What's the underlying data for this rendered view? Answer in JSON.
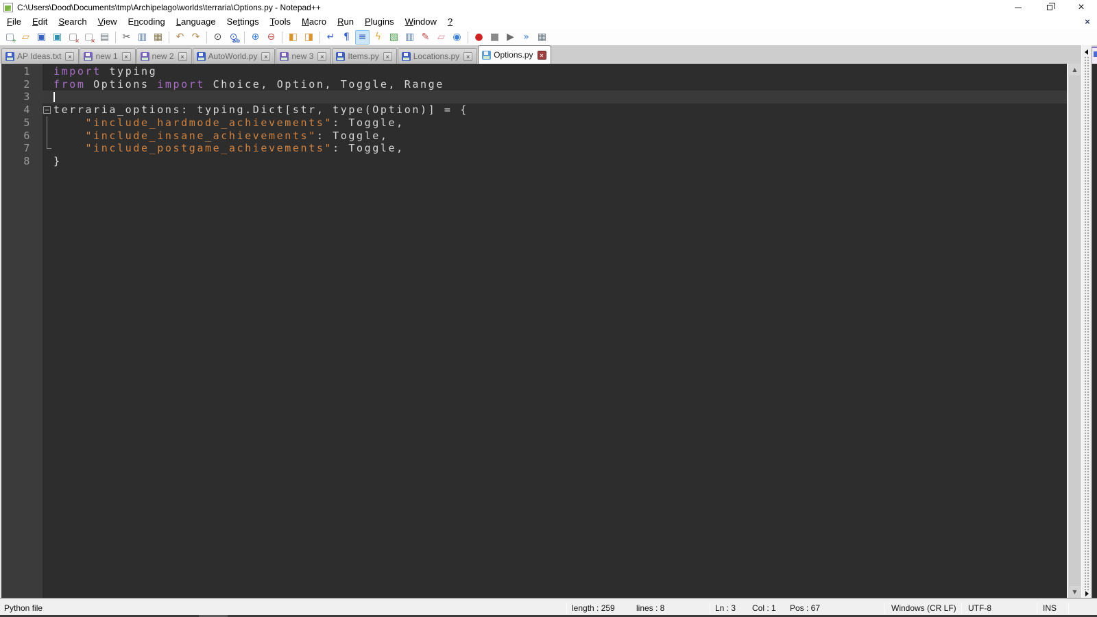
{
  "window": {
    "title": "C:\\Users\\Dood\\Documents\\tmp\\Archipelago\\worlds\\terraria\\Options.py - Notepad++"
  },
  "menu": {
    "items": [
      {
        "label": "File",
        "mnemonic": 0
      },
      {
        "label": "Edit",
        "mnemonic": 0
      },
      {
        "label": "Search",
        "mnemonic": 0
      },
      {
        "label": "View",
        "mnemonic": 0
      },
      {
        "label": "Encoding",
        "mnemonic": 1
      },
      {
        "label": "Language",
        "mnemonic": 0
      },
      {
        "label": "Settings",
        "mnemonic": 2
      },
      {
        "label": "Tools",
        "mnemonic": 0
      },
      {
        "label": "Macro",
        "mnemonic": 0
      },
      {
        "label": "Run",
        "mnemonic": 0
      },
      {
        "label": "Plugins",
        "mnemonic": 0
      },
      {
        "label": "Window",
        "mnemonic": 0
      },
      {
        "label": "?",
        "mnemonic": 0
      }
    ],
    "close_button_glyph": "×"
  },
  "toolbar": {
    "items": [
      {
        "name": "new-file",
        "glyph": "▢",
        "color": "#7d8aa0",
        "badge": "+",
        "badge_color": "#3a9e3a"
      },
      {
        "name": "open-file",
        "glyph": "▱",
        "color": "#d9952f"
      },
      {
        "name": "save",
        "glyph": "▣",
        "color": "#3a62c4"
      },
      {
        "name": "save-all",
        "glyph": "▣",
        "color": "#2f8fae"
      },
      {
        "name": "close",
        "glyph": "▢",
        "color": "#8a8a8a",
        "badge": "×",
        "badge_color": "#c0504d"
      },
      {
        "name": "close-all",
        "glyph": "▢",
        "color": "#9a9a9a",
        "badge": "×",
        "badge_color": "#c0504d"
      },
      {
        "name": "print",
        "glyph": "▤",
        "color": "#6c7a89"
      },
      {
        "sep": true
      },
      {
        "name": "cut",
        "glyph": "✂",
        "color": "#5a5a5a"
      },
      {
        "name": "copy",
        "glyph": "▥",
        "color": "#5b7fb5"
      },
      {
        "name": "paste",
        "glyph": "▦",
        "color": "#8a7a52"
      },
      {
        "sep": true
      },
      {
        "name": "undo",
        "glyph": "↶",
        "color": "#b08a4f"
      },
      {
        "name": "redo",
        "glyph": "↷",
        "color": "#b08a4f"
      },
      {
        "sep": true
      },
      {
        "name": "find",
        "glyph": "⊙",
        "color": "#444444"
      },
      {
        "name": "replace",
        "glyph": "⊙",
        "color": "#3a62c4",
        "badge": "ab",
        "badge_color": "#3a62c4"
      },
      {
        "sep": true
      },
      {
        "name": "zoom-in",
        "glyph": "⊕",
        "color": "#3a7fd5"
      },
      {
        "name": "zoom-out",
        "glyph": "⊖",
        "color": "#c0504d"
      },
      {
        "sep": true
      },
      {
        "name": "sync-vertical",
        "glyph": "◧",
        "color": "#d9952f"
      },
      {
        "name": "sync-horizontal",
        "glyph": "◨",
        "color": "#d9952f"
      },
      {
        "sep": true
      },
      {
        "name": "word-wrap",
        "glyph": "↵",
        "color": "#3a62c4"
      },
      {
        "name": "show-all-characters",
        "glyph": "¶",
        "color": "#3a62c4"
      },
      {
        "name": "indent-guide",
        "glyph": "≡",
        "color": "#3a62c4",
        "pressed": true
      },
      {
        "name": "function-list",
        "glyph": "ϟ",
        "color": "#e0a526"
      },
      {
        "name": "document-map",
        "glyph": "▧",
        "color": "#4a9e4a"
      },
      {
        "name": "document-list",
        "glyph": "▥",
        "color": "#5b7fb5"
      },
      {
        "name": "document-switcher",
        "glyph": "✎",
        "color": "#c0504d"
      },
      {
        "name": "folder-as-workspace",
        "glyph": "▱",
        "color": "#d98a9a"
      },
      {
        "name": "file-monitoring",
        "glyph": "◉",
        "color": "#3a7fd5"
      },
      {
        "sep": true
      },
      {
        "name": "macro-record",
        "glyph": "●",
        "color": "#cc2222"
      },
      {
        "name": "macro-stop",
        "glyph": "■",
        "color": "#8a8a8a"
      },
      {
        "name": "macro-play",
        "glyph": "▶",
        "color": "#6a6a6a"
      },
      {
        "name": "macro-run-multiple",
        "glyph": "»",
        "color": "#3a7fd5"
      },
      {
        "name": "macro-save",
        "glyph": "▦",
        "color": "#6c7a89"
      }
    ]
  },
  "tabs": [
    {
      "label": "AP Ideas.txt",
      "state": "saved"
    },
    {
      "label": "new 1",
      "state": "new"
    },
    {
      "label": "new 2",
      "state": "new"
    },
    {
      "label": "AutoWorld.py",
      "state": "saved"
    },
    {
      "label": "new 3",
      "state": "new"
    },
    {
      "label": "Items.py",
      "state": "saved"
    },
    {
      "label": "Locations.py",
      "state": "saved"
    },
    {
      "label": "Options.py",
      "state": "active"
    }
  ],
  "icons": {
    "tab_close": "×",
    "fold_collapse": "−",
    "scroll_up": "▲",
    "scroll_down": "▼"
  },
  "editor": {
    "caret": {
      "line": 3,
      "col": 1
    },
    "lines": [
      {
        "num": "1",
        "fold": "",
        "segs": [
          {
            "t": "import",
            "c": "kw"
          },
          {
            "t": " typing",
            "c": "pl"
          }
        ]
      },
      {
        "num": "2",
        "fold": "",
        "segs": [
          {
            "t": "from",
            "c": "kw"
          },
          {
            "t": " Options ",
            "c": "pl"
          },
          {
            "t": "import",
            "c": "kw"
          },
          {
            "t": " Choice, Option, Toggle, Range",
            "c": "pl"
          }
        ]
      },
      {
        "num": "3",
        "fold": "",
        "segs": []
      },
      {
        "num": "4",
        "fold": "box",
        "segs": [
          {
            "t": "terraria_options: typing.Dict[str, type(Option)] = {",
            "c": "pl"
          }
        ]
      },
      {
        "num": "5",
        "fold": "line",
        "segs": [
          {
            "t": "    ",
            "c": "pl"
          },
          {
            "t": "\"include_hardmode_achievements\"",
            "c": "str"
          },
          {
            "t": ": Toggle,",
            "c": "pl"
          }
        ]
      },
      {
        "num": "6",
        "fold": "line",
        "segs": [
          {
            "t": "    ",
            "c": "pl"
          },
          {
            "t": "\"include_insane_achievements\"",
            "c": "str"
          },
          {
            "t": ": Toggle,",
            "c": "pl"
          }
        ]
      },
      {
        "num": "7",
        "fold": "corner",
        "segs": [
          {
            "t": "    ",
            "c": "pl"
          },
          {
            "t": "\"include_postgame_achievements\"",
            "c": "str"
          },
          {
            "t": ": Toggle,",
            "c": "pl"
          }
        ]
      },
      {
        "num": "8",
        "fold": "",
        "segs": [
          {
            "t": "}",
            "c": "pl"
          }
        ]
      }
    ]
  },
  "status": {
    "doc_type": "Python file",
    "length_label": "length : 259",
    "lines_label": "lines : 8",
    "ln": "Ln : 3",
    "col": "Col : 1",
    "pos": "Pos : 67",
    "eol": "Windows (CR LF)",
    "encoding": "UTF-8",
    "insert_mode": "INS"
  },
  "colors": {
    "editor_bg": "#2d2d2d",
    "gutter_bg": "#3b3b3b",
    "current_line_bg": "#3a3a3a",
    "keyword": "#a86cc6",
    "string": "#d2823f",
    "plain": "#d8d8d8",
    "line_number": "#9a9a9a",
    "active_tab_close_bg": "#9c4040"
  }
}
